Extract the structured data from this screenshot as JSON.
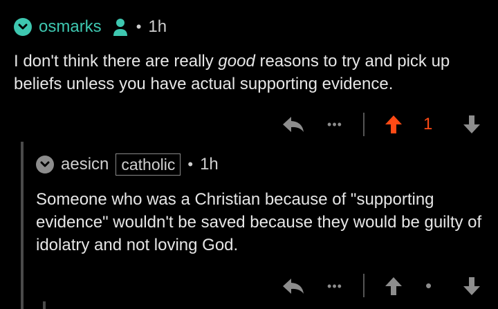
{
  "colors": {
    "background": "#000000",
    "accent": "#3ec7b0",
    "upvote": "#ff4a15",
    "muted": "#8d8d8d",
    "text": "#e6e6e6"
  },
  "comment1": {
    "username": "osmarks",
    "separator": "•",
    "time": "1h",
    "text_before": "I don't think there are really ",
    "text_emphasis": "good",
    "text_after": " reasons to try and pick up beliefs unless you have actual supporting evidence.",
    "score": "1",
    "more_label": "•••",
    "icons": [
      "chevron-down-icon",
      "user-icon",
      "reply-icon",
      "upvote-icon",
      "downvote-icon"
    ]
  },
  "comment2": {
    "username": "aesicn",
    "flair": "catholic",
    "separator": "•",
    "time": "1h",
    "text": "Someone who was a Christian because of \"supporting evidence\" wouldn't be saved because they would be guilty of idolatry and not loving God.",
    "score": "•",
    "more_label": "•••",
    "icons": [
      "chevron-down-icon",
      "reply-icon",
      "upvote-icon",
      "downvote-icon"
    ]
  }
}
